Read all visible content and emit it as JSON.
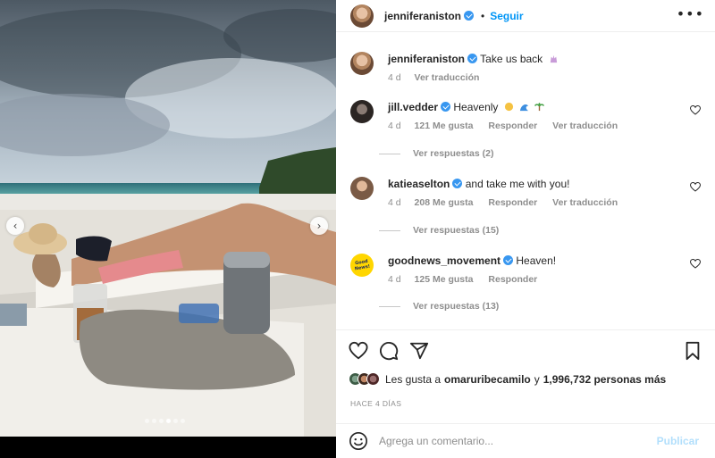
{
  "post": {
    "author": "jenniferaniston",
    "separator": "•",
    "follow_label": "Seguir",
    "more_label": "•••",
    "caption": "Take us back",
    "caption_age": "4 d",
    "caption_translate": "Ver traducción",
    "carousel": {
      "slides": 6,
      "active_index": 3
    }
  },
  "comments": [
    {
      "username": "jill.vedder",
      "text": "Heavenly",
      "emoji_names": [
        "sun-emoji",
        "wave-emoji",
        "palm-tree-emoji"
      ],
      "age": "4 d",
      "likes": "121 Me gusta",
      "reply_label": "Responder",
      "translate_label": "Ver traducción",
      "view_replies": "Ver respuestas (2)"
    },
    {
      "username": "katieaselton",
      "text": "and take me with you!",
      "age": "4 d",
      "likes": "208 Me gusta",
      "reply_label": "Responder",
      "translate_label": "Ver traducción",
      "view_replies": "Ver respuestas (15)"
    },
    {
      "username": "goodnews_movement",
      "avatar_text": "Good News!",
      "text": "Heaven!",
      "age": "4 d",
      "likes": "125 Me gusta",
      "reply_label": "Responder",
      "view_replies": "Ver respuestas (13)"
    }
  ],
  "likes_summary": {
    "prefix": "Les gusta a",
    "user": "omaruribecamilo",
    "connector": "y",
    "count": "1,996,732 personas más"
  },
  "timestamp": "HACE 4 DÍAS",
  "add_comment": {
    "placeholder": "Agrega un comentario...",
    "publish_label": "Publicar"
  },
  "colors": {
    "accent": "#0095f6",
    "verified": "#3897f0",
    "muted": "#8e8e8e",
    "publish_disabled": "#b2dffc"
  }
}
